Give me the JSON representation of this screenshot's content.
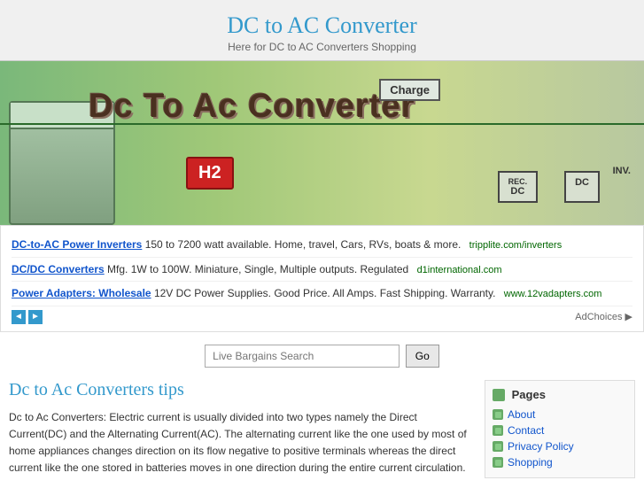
{
  "header": {
    "title": "DC to AC Converter",
    "subtitle": "Here for DC to AC Converters Shopping"
  },
  "banner": {
    "title": "Dc To Ac Converter",
    "charge_label": "Charge",
    "h2_label": "H2",
    "box1_top": "REC.",
    "box1_main": "DC",
    "box2_main": "DC",
    "inv_label": "INV."
  },
  "ads": [
    {
      "link_text": "DC-to-AC Power Inverters",
      "description": " 150 to 7200 watt available. Home, travel, Cars, RVs, boats & more.",
      "url": "tripplite.com/inverters"
    },
    {
      "link_text": "DC/DC Converters",
      "description": " Mfg. 1W to 100W. Miniature, Single, Multiple outputs. Regulated",
      "url": "d1international.com"
    },
    {
      "link_text": "Power Adapters: Wholesale",
      "description": " 12V DC Power Supplies. Good Price. All Amps. Fast Shipping. Warranty.",
      "url": "www.12vadapters.com"
    }
  ],
  "search": {
    "placeholder": "Live Bargains Search",
    "button": "Go"
  },
  "article": {
    "title": "Dc to Ac Converters tips",
    "body": "Dc to Ac Converters: Electric current is usually divided into two types namely the Direct Current(DC) and the Alternating Current(AC). The alternating current like the one used by most of home appliances changes direction on its flow negative to positive terminals whereas the direct current like the one stored in batteries moves in one direction during the entire current circulation."
  },
  "sidebar": {
    "pages_label": "Pages",
    "items": [
      {
        "label": "About"
      },
      {
        "label": "Contact"
      },
      {
        "label": "Privacy Policy"
      },
      {
        "label": "Shopping"
      }
    ]
  },
  "ad_nav": {
    "prev": "◄",
    "next": "►",
    "ad_choices": "AdChoices ▶"
  }
}
